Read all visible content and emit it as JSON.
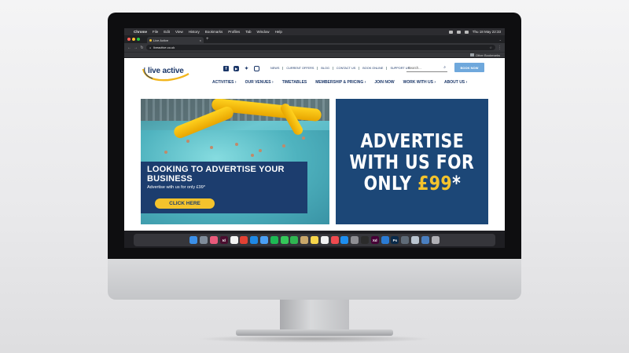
{
  "mac_menubar": {
    "app_name": "Chrome",
    "menus": [
      "File",
      "Edit",
      "View",
      "History",
      "Bookmarks",
      "Profiles",
      "Tab",
      "Window",
      "Help"
    ],
    "clock": "Thu 18 May  22:33"
  },
  "browser": {
    "tab_title": "Live Active",
    "url": "liveactive.co.uk",
    "bookmark_folder": "Other Bookmarks"
  },
  "site": {
    "logo_text": "live active",
    "social_icons": [
      "facebook-icon",
      "youtube-icon",
      "twitter-icon",
      "instagram-icon"
    ],
    "top_links": [
      "NEWS",
      "CURRENT OFFERS",
      "BLOG",
      "CONTACT US",
      "BOOK ONLINE",
      "SUPPORT US"
    ],
    "search_placeholder": "Search...",
    "book_now": "BOOK NOW",
    "main_nav": [
      "ACTIVITIES ›",
      "OUR VENUES ›",
      "TIMETABLES",
      "MEMBERSHIP & PRICING ›",
      "JOIN NOW",
      "WORK WITH US ›",
      "ABOUT US ›"
    ],
    "hero": {
      "title": "LOOKING TO ADVERTISE YOUR BUSINESS",
      "subtitle": "Advertise with us for only £99*",
      "button": "CLICK HERE"
    },
    "ad_panel": {
      "line1": "ADVERTISE",
      "line2": "WITH US FOR",
      "line3_prefix": "ONLY ",
      "price": "£99",
      "asterisk": "*"
    }
  },
  "dock": {
    "apps": [
      {
        "name": "finder-icon",
        "color": "#3b8fe8",
        "label": ""
      },
      {
        "name": "launchpad-icon",
        "color": "#7f8c9a",
        "label": ""
      },
      {
        "name": "photos-icon",
        "color": "#e95a7b",
        "label": ""
      },
      {
        "name": "indesign-icon",
        "color": "#4a0e2f",
        "label": "Id"
      },
      {
        "name": "calendar-icon",
        "color": "#f3f3f3",
        "label": ""
      },
      {
        "name": "chrome-icon",
        "color": "#e34133",
        "label": ""
      },
      {
        "name": "safari-icon",
        "color": "#1e88e5",
        "label": ""
      },
      {
        "name": "mail-icon",
        "color": "#4a9ff5",
        "label": ""
      },
      {
        "name": "spotify-icon",
        "color": "#1db954",
        "label": ""
      },
      {
        "name": "messages-icon",
        "color": "#34c759",
        "label": ""
      },
      {
        "name": "facetime-icon",
        "color": "#2fb551",
        "label": ""
      },
      {
        "name": "contacts-icon",
        "color": "#c9a76a",
        "label": ""
      },
      {
        "name": "notes-icon",
        "color": "#f7d54a",
        "label": ""
      },
      {
        "name": "reminders-icon",
        "color": "#f2f2f2",
        "label": ""
      },
      {
        "name": "news-icon",
        "color": "#f04a4f",
        "label": ""
      },
      {
        "name": "appstore-icon",
        "color": "#1d8ef0",
        "label": ""
      },
      {
        "name": "settings-icon",
        "color": "#8e8e93",
        "label": ""
      },
      {
        "name": "terminal-icon",
        "color": "#2b2b2b",
        "label": ""
      },
      {
        "name": "xd-icon",
        "color": "#470137",
        "label": "Xd"
      },
      {
        "name": "vscode-icon",
        "color": "#2a7bd4",
        "label": ""
      },
      {
        "name": "photoshop-icon",
        "color": "#0a2a4a",
        "label": "Ps"
      },
      {
        "name": "finder-window-icon",
        "color": "#5f6b78",
        "label": ""
      },
      {
        "name": "preview-icon",
        "color": "#b9c4d0",
        "label": ""
      },
      {
        "name": "downloads-icon",
        "color": "#4a7fc0",
        "label": ""
      },
      {
        "name": "trash-icon",
        "color": "#b0b0b5",
        "label": ""
      }
    ]
  }
}
